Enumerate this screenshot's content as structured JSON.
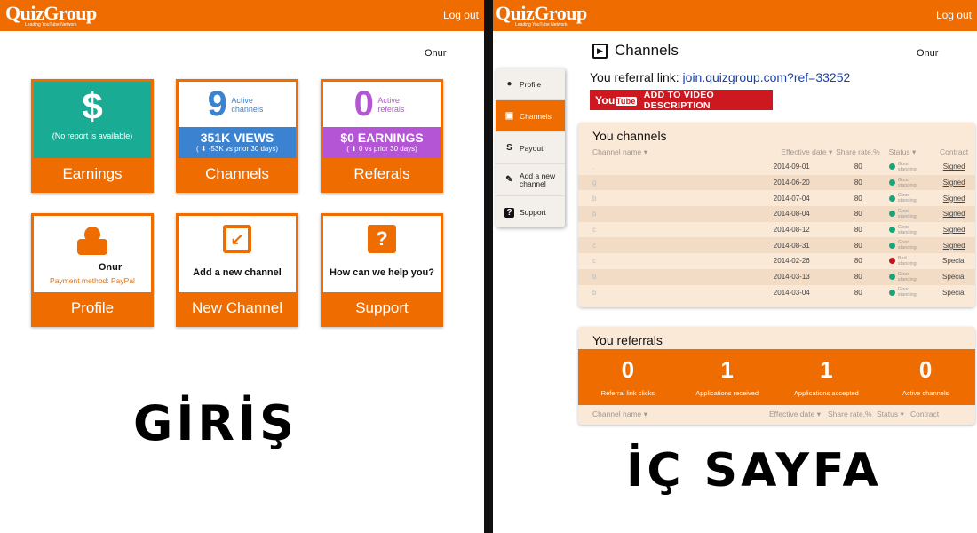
{
  "brand": {
    "name": "QuizGroup",
    "tagline": "Leading YouTube Network",
    "logout": "Log out"
  },
  "user": "Onur",
  "left": {
    "cards": [
      {
        "icon": "dollar-icon",
        "glyph": "$",
        "text": "(No report is available)",
        "footer": "Earnings",
        "color": "#1aab95"
      },
      {
        "number": "9",
        "label": "Active channels",
        "band_main": "351K VIEWS",
        "band_sub": "( ⬇ -53K vs prior 30 days)",
        "footer": "Channels",
        "color": "#3b82d1"
      },
      {
        "number": "0",
        "label": "Active referals",
        "band_main": "$0 EARNINGS",
        "band_sub": "( ⬆ 0 vs prior 30 days)",
        "footer": "Referals",
        "color": "#b455d6"
      },
      {
        "icon": "user-icon",
        "name": "Onur",
        "sub": "Payment method: PayPal",
        "footer": "Profile"
      },
      {
        "icon": "edit-icon",
        "text": "Add a new channel",
        "footer": "New Channel"
      },
      {
        "icon": "question-icon",
        "glyph": "?",
        "text": "How can we help you?",
        "footer": "Support"
      }
    ],
    "caption": "GİRİŞ"
  },
  "right": {
    "title": "Channels",
    "referral_label": "You referral link:",
    "referral_link": "join.quizgroup.com?ref=33252",
    "youtube_button": "ADD TO VIDEO DESCRIPTION",
    "youtube_logo": "YouTube",
    "sidebar": [
      "Profile",
      "Channels",
      "Payout",
      "Add a new channel",
      "Support"
    ],
    "channels": {
      "title": "You channels",
      "columns": [
        "Channel name ▾",
        "Effective date ▾",
        "Share rate,%",
        "Status ▾",
        "Contract"
      ],
      "rows": [
        {
          "name": ".",
          "date": "2014-09-01",
          "rate": "80",
          "status": "Good standing",
          "good": true,
          "contract": "Signed"
        },
        {
          "name": "g",
          "date": "2014-06-20",
          "rate": "80",
          "status": "Good standing",
          "good": true,
          "contract": "Signed"
        },
        {
          "name": "b",
          "date": "2014-07-04",
          "rate": "80",
          "status": "Good standing",
          "good": true,
          "contract": "Signed"
        },
        {
          "name": "b",
          "date": "2014-08-04",
          "rate": "80",
          "status": "Good standing",
          "good": true,
          "contract": "Signed"
        },
        {
          "name": "c",
          "date": "2014-08-12",
          "rate": "80",
          "status": "Good standing",
          "good": true,
          "contract": "Signed"
        },
        {
          "name": "c",
          "date": "2014-08-31",
          "rate": "80",
          "status": "Good standing",
          "good": true,
          "contract": "Signed"
        },
        {
          "name": "c",
          "date": "2014-02-26",
          "rate": "80",
          "status": "Bad standing",
          "good": false,
          "contract": "Special"
        },
        {
          "name": "b",
          "date": "2014-03-13",
          "rate": "80",
          "status": "Good standing",
          "good": true,
          "contract": "Special"
        },
        {
          "name": "b",
          "date": "2014-03-04",
          "rate": "80",
          "status": "Good standing",
          "good": true,
          "contract": "Special"
        }
      ]
    },
    "referrals": {
      "title": "You referrals",
      "stats": [
        {
          "value": "0",
          "label": "Referral link clicks"
        },
        {
          "value": "1",
          "label": "Applications received"
        },
        {
          "value": "1",
          "label": "Applications accepted"
        },
        {
          "value": "0",
          "label": "Active channels"
        }
      ],
      "columns": [
        "Channel name ▾",
        "Effective date ▾",
        "Share rate,%",
        "Status ▾",
        "Contract"
      ]
    },
    "caption": "İÇ SAYFA"
  },
  "colors": {
    "orange": "#ef6c00",
    "good": "#1aa37a",
    "bad": "#c0141c",
    "link": "#1a3fb0",
    "youtube": "#cc181e"
  }
}
